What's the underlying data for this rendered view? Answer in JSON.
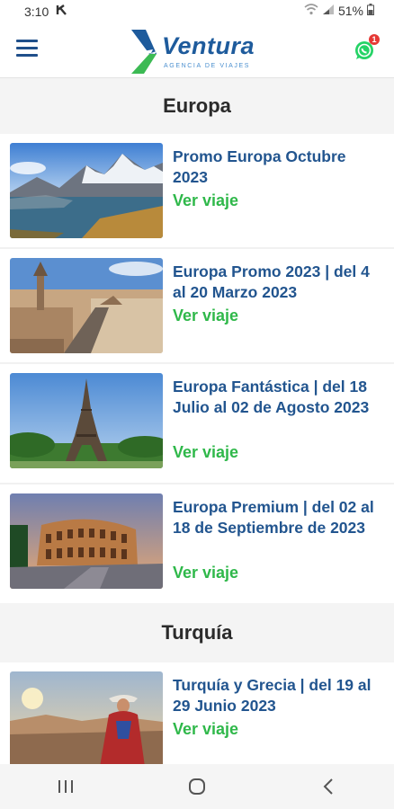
{
  "status": {
    "time": "3:10",
    "battery": "51%"
  },
  "app": {
    "name": "Ventura",
    "tagline": "AGENCIA DE VIAJES",
    "whatsapp_badge": "1"
  },
  "sections": [
    {
      "title": "Europa",
      "items": [
        {
          "title": "Promo Europa Octubre 2023",
          "link": "Ver viaje"
        },
        {
          "title": "Europa Promo 2023 | del 4 al 20 Marzo 2023",
          "link": "Ver viaje"
        },
        {
          "title": "Europa Fantástica | del 18 Julio al 02 de Agosto 2023",
          "link": "Ver viaje"
        },
        {
          "title": "Europa Premium | del 02 al 18 de Septiembre de 2023",
          "link": "Ver viaje"
        }
      ]
    },
    {
      "title": "Turquía",
      "items": [
        {
          "title": "Turquía y Grecia | del 19 al 29 Junio 2023",
          "link": "Ver viaje"
        }
      ]
    }
  ],
  "colors": {
    "brand_blue": "#1e5b9c",
    "title_blue": "#22558f",
    "link_green": "#2fb84a",
    "whatsapp": "#25d366",
    "badge": "#e53935"
  }
}
